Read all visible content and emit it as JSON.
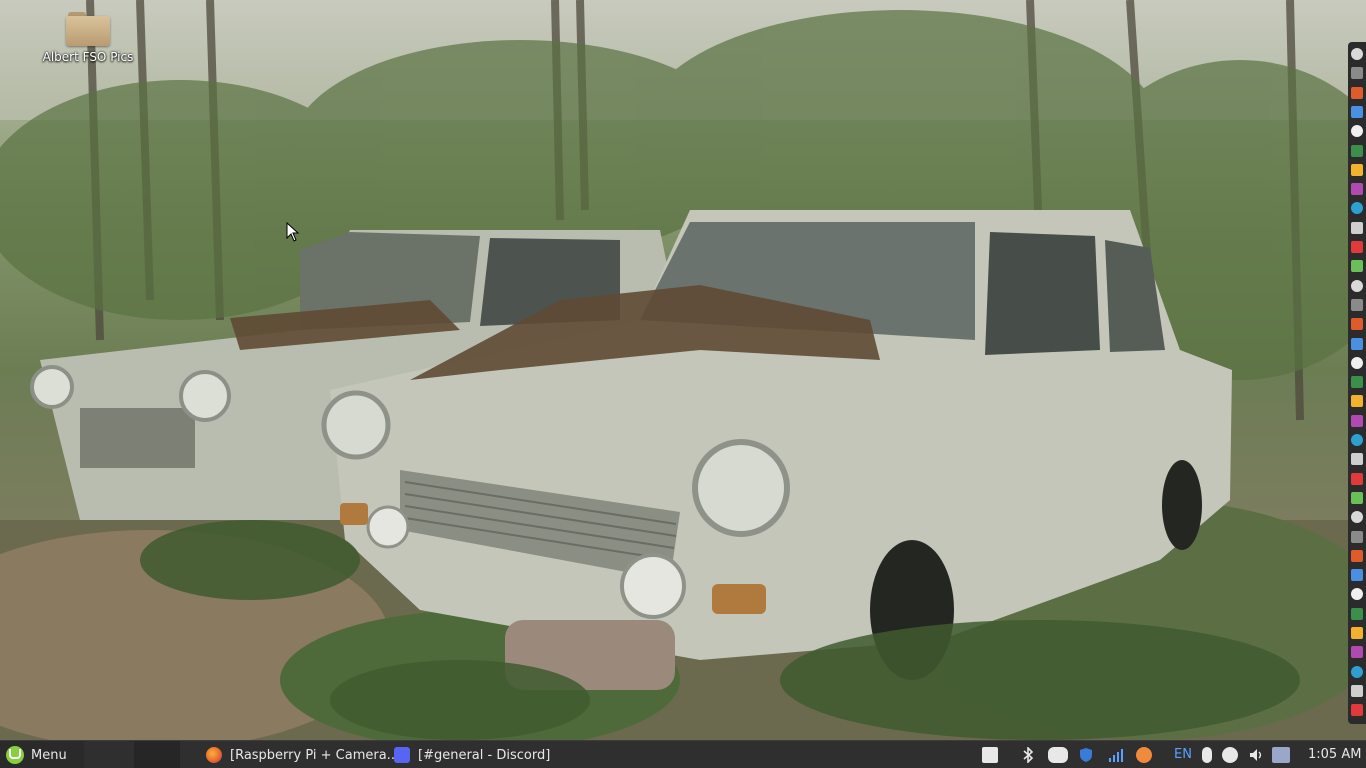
{
  "desktop": {
    "icons": [
      {
        "label": "Albert FSO Pics",
        "icon": "folder-icon"
      }
    ]
  },
  "taskbar": {
    "menu_label": "Menu",
    "tasks": [
      {
        "label": "[Raspberry Pi + Camera...",
        "icon": "firefox-icon"
      },
      {
        "label": "[#general - Discord]",
        "icon": "discord-icon"
      }
    ],
    "tray": {
      "language": "EN",
      "clock": "1:05 AM",
      "icons": [
        "keyboard-icon",
        "bluetooth-icon",
        "discord-tray-icon",
        "shield-icon",
        "network-signal-icon",
        "notification-icon",
        "input-method-icon",
        "steam-icon",
        "volume-icon",
        "battery-icon"
      ]
    }
  },
  "side_panel": {
    "icons": [
      "pinned-app-1",
      "pinned-app-2",
      "pinned-app-3",
      "pinned-app-4",
      "pinned-app-5",
      "pinned-app-6",
      "pinned-app-7",
      "pinned-app-8",
      "pinned-app-9",
      "pinned-app-10",
      "pinned-app-11",
      "pinned-app-12",
      "pinned-app-13",
      "pinned-app-14",
      "pinned-app-15",
      "pinned-app-16",
      "pinned-app-17",
      "pinned-app-18",
      "pinned-app-19",
      "pinned-app-20",
      "pinned-app-21",
      "pinned-app-22",
      "pinned-app-23",
      "pinned-app-24",
      "pinned-app-25",
      "pinned-app-26",
      "pinned-app-27",
      "pinned-app-28",
      "pinned-app-29",
      "pinned-app-30",
      "pinned-app-31",
      "pinned-app-32",
      "pinned-app-33",
      "pinned-app-34",
      "pinned-app-35"
    ]
  },
  "colors": {
    "panel": "#2f2f2f",
    "mint_green": "#87cf3e",
    "accent_blue": "#5aa0ff"
  }
}
